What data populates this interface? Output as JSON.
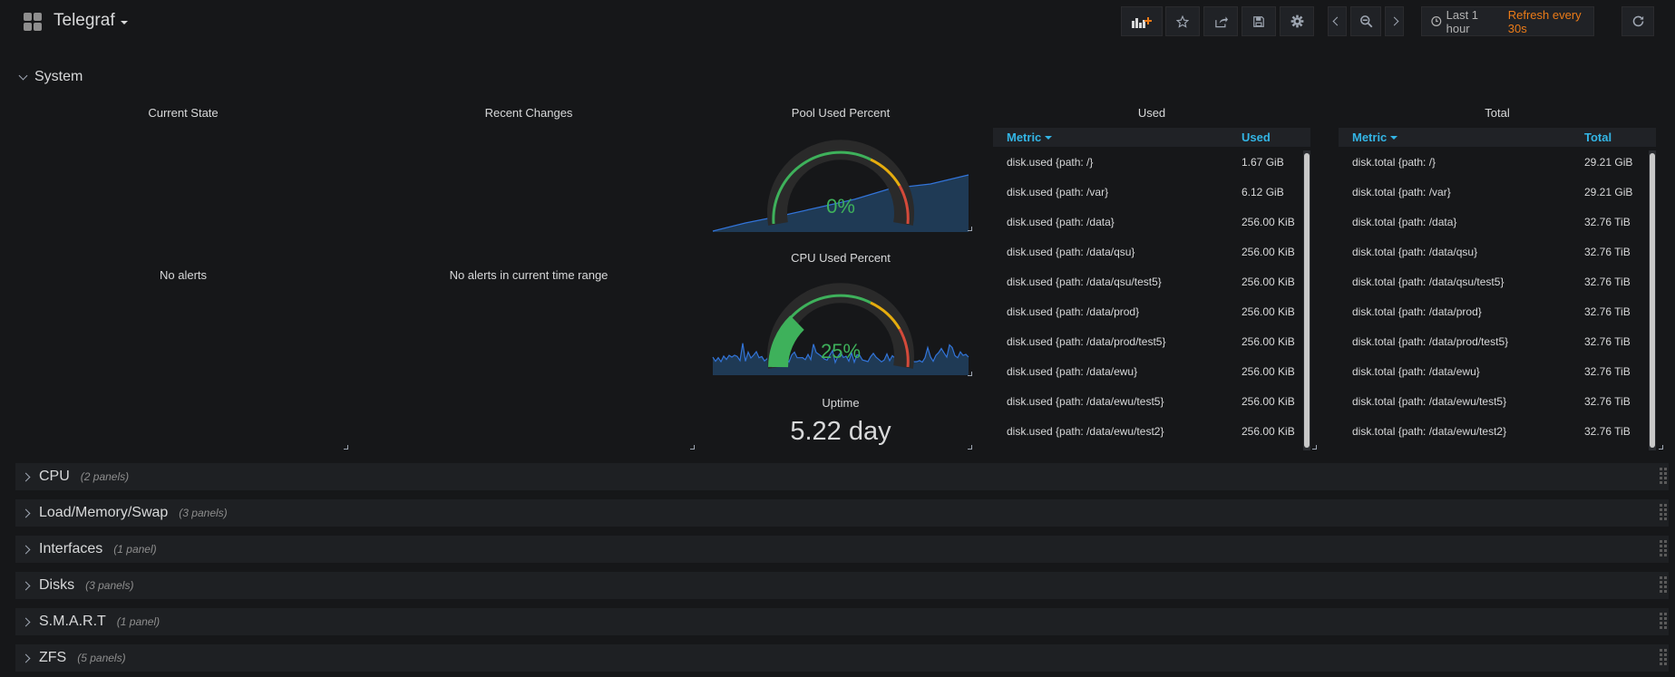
{
  "header": {
    "title": "Telegraf",
    "time_range": "Last 1 hour",
    "refresh": "Refresh every 30s"
  },
  "row_open": {
    "title": "System"
  },
  "panels": {
    "current_state": {
      "title": "Current State",
      "message": "No alerts"
    },
    "recent_changes": {
      "title": "Recent Changes",
      "message": "No alerts in current time range"
    },
    "pool_used": {
      "title": "Pool Used Percent",
      "value": "0%",
      "fraction": 0.0
    },
    "cpu_used": {
      "title": "CPU Used Percent",
      "value": "25%",
      "fraction": 0.25
    },
    "uptime": {
      "title": "Uptime",
      "value": "5.22 day"
    },
    "used_table": {
      "title": "Used",
      "col1": "Metric",
      "col2": "Used",
      "rows": [
        [
          "disk.used {path: /}",
          "1.67 GiB"
        ],
        [
          "disk.used {path: /var}",
          "6.12 GiB"
        ],
        [
          "disk.used {path: /data}",
          "256.00 KiB"
        ],
        [
          "disk.used {path: /data/qsu}",
          "256.00 KiB"
        ],
        [
          "disk.used {path: /data/qsu/test5}",
          "256.00 KiB"
        ],
        [
          "disk.used {path: /data/prod}",
          "256.00 KiB"
        ],
        [
          "disk.used {path: /data/prod/test5}",
          "256.00 KiB"
        ],
        [
          "disk.used {path: /data/ewu}",
          "256.00 KiB"
        ],
        [
          "disk.used {path: /data/ewu/test5}",
          "256.00 KiB"
        ],
        [
          "disk.used {path: /data/ewu/test2}",
          "256.00 KiB"
        ]
      ]
    },
    "total_table": {
      "title": "Total",
      "col1": "Metric",
      "col2": "Total",
      "rows": [
        [
          "disk.total {path: /}",
          "29.21 GiB"
        ],
        [
          "disk.total {path: /var}",
          "29.21 GiB"
        ],
        [
          "disk.total {path: /data}",
          "32.76 TiB"
        ],
        [
          "disk.total {path: /data/qsu}",
          "32.76 TiB"
        ],
        [
          "disk.total {path: /data/qsu/test5}",
          "32.76 TiB"
        ],
        [
          "disk.total {path: /data/prod}",
          "32.76 TiB"
        ],
        [
          "disk.total {path: /data/prod/test5}",
          "32.76 TiB"
        ],
        [
          "disk.total {path: /data/ewu}",
          "32.76 TiB"
        ],
        [
          "disk.total {path: /data/ewu/test5}",
          "32.76 TiB"
        ],
        [
          "disk.total {path: /data/ewu/test2}",
          "32.76 TiB"
        ]
      ]
    }
  },
  "collapsed_rows": [
    {
      "name": "CPU",
      "count": "(2 panels)"
    },
    {
      "name": "Load/Memory/Swap",
      "count": "(3 panels)"
    },
    {
      "name": "Interfaces",
      "count": "(1 panel)"
    },
    {
      "name": "Disks",
      "count": "(3 panels)"
    },
    {
      "name": "S.M.A.R.T",
      "count": "(1 panel)"
    },
    {
      "name": "ZFS",
      "count": "(5 panels)"
    }
  ],
  "colors": {
    "accent_blue": "#33b5e5",
    "orange": "#eb7b18",
    "green": "#3eb15b",
    "red": "#d44a3a"
  }
}
